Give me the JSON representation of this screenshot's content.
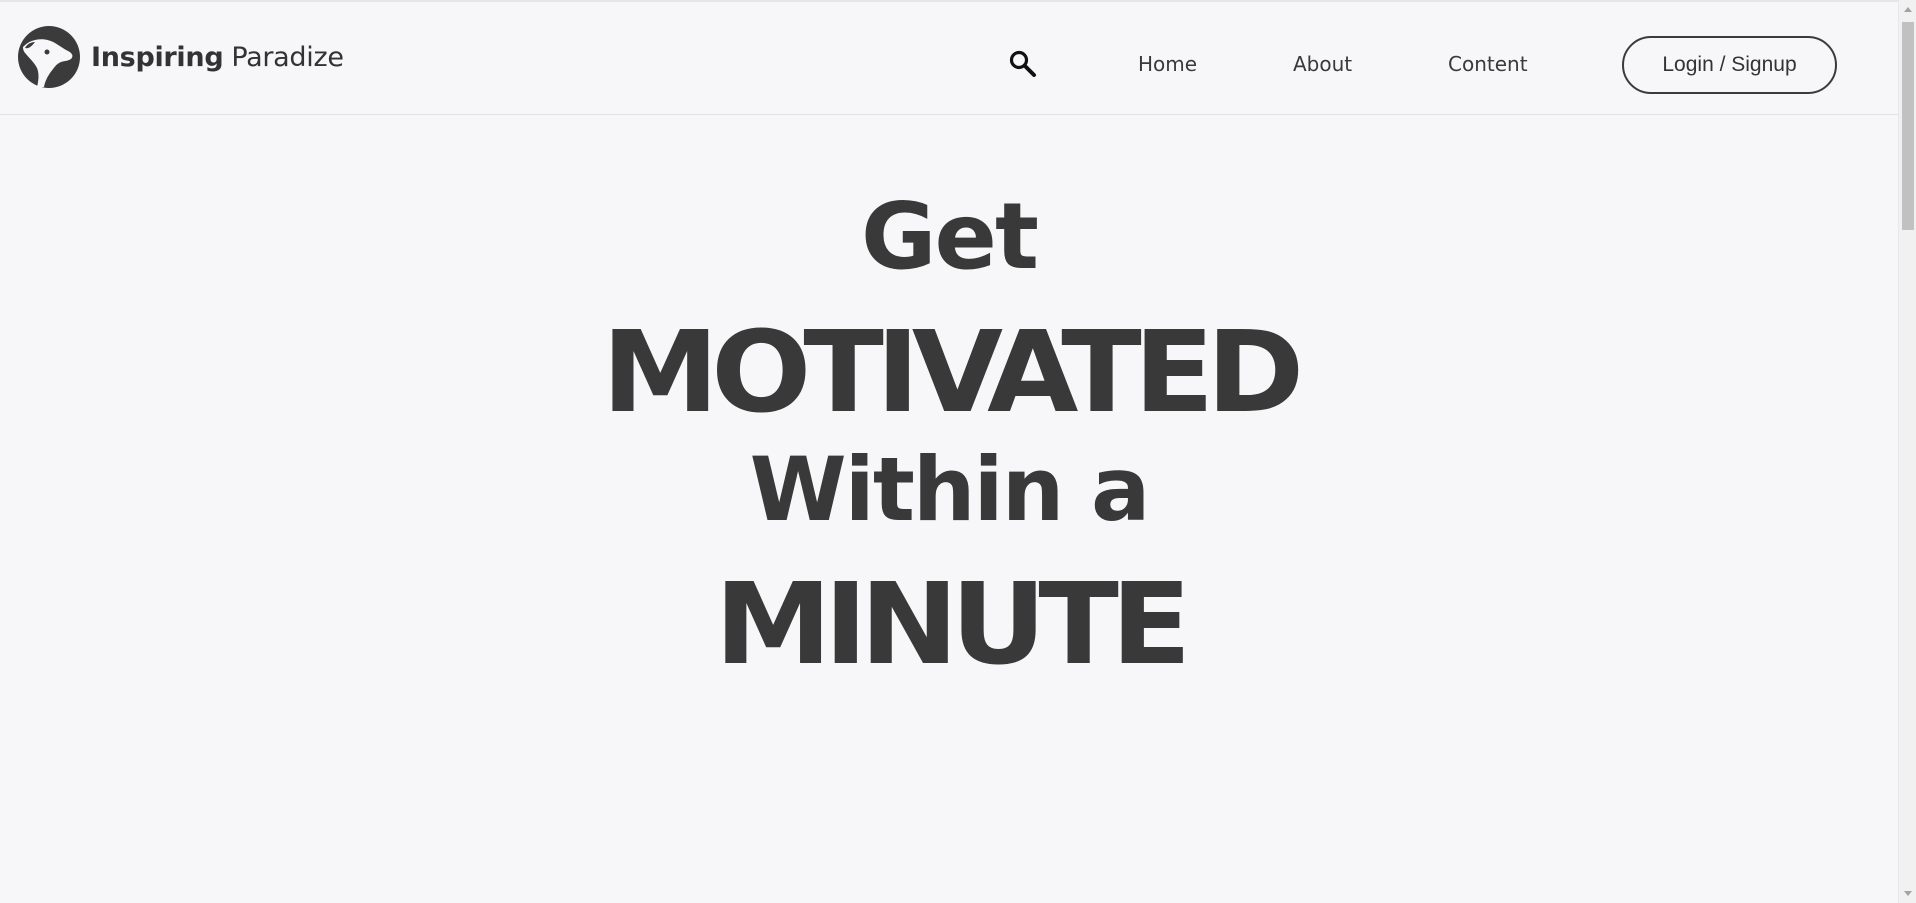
{
  "header": {
    "brand_bold": "Inspiring",
    "brand_light": "Paradize",
    "logo_icon": "dog-head-logo-icon",
    "search_icon": "search-icon",
    "nav": {
      "home": "Home",
      "about": "About",
      "content": "Content"
    },
    "login_label": "Login / Signup"
  },
  "hero": {
    "line1": "Get",
    "line2": "MOTIVATED",
    "line3": "Within a",
    "line4": "MINUTE"
  },
  "colors": {
    "background": "#f7f7f9",
    "text": "#393939",
    "border": "#3b3b3b"
  }
}
